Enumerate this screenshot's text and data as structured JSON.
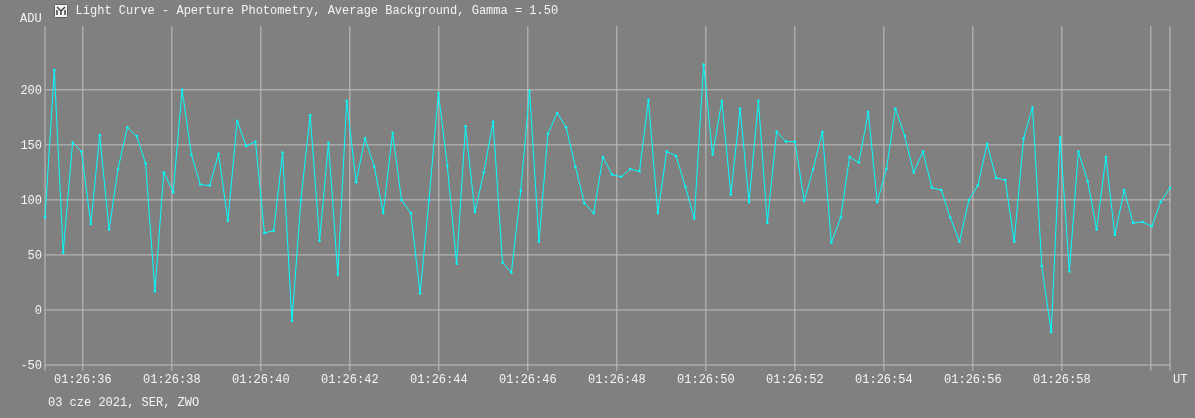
{
  "window": {
    "title": "Light Curve - Aperture Photometry, Average Background, Gamma = 1.50"
  },
  "chart": {
    "chart_data": {
      "type": "line",
      "xlabel": "UT",
      "ylabel": "ADU",
      "x": [
        5195.15,
        5195.36,
        5195.56,
        5195.77,
        5195.97,
        5196.18,
        5196.38,
        5196.59,
        5196.79,
        5197.0,
        5197.21,
        5197.41,
        5197.62,
        5197.82,
        5198.03,
        5198.23,
        5198.44,
        5198.64,
        5198.85,
        5199.05,
        5199.26,
        5199.47,
        5199.67,
        5199.88,
        5200.08,
        5200.29,
        5200.49,
        5200.7,
        5200.9,
        5201.11,
        5201.32,
        5201.52,
        5201.73,
        5201.93,
        5202.14,
        5202.34,
        5202.55,
        5202.75,
        5202.96,
        5203.16,
        5203.37,
        5203.58,
        5203.78,
        5203.99,
        5204.19,
        5204.4,
        5204.6,
        5204.81,
        5205.01,
        5205.22,
        5205.43,
        5205.63,
        5205.84,
        5206.04,
        5206.25,
        5206.45,
        5206.66,
        5206.86,
        5207.07,
        5207.27,
        5207.48,
        5207.69,
        5207.89,
        5208.1,
        5208.3,
        5208.51,
        5208.71,
        5208.92,
        5209.12,
        5209.33,
        5209.54,
        5209.74,
        5209.95,
        5210.15,
        5210.36,
        5210.56,
        5210.77,
        5210.97,
        5211.18,
        5211.38,
        5211.59,
        5211.8,
        5212.0,
        5212.21,
        5212.41,
        5212.62,
        5212.82,
        5213.03,
        5213.23,
        5213.44,
        5213.65,
        5213.85,
        5214.06,
        5214.26,
        5214.47,
        5214.67,
        5214.88,
        5215.08,
        5215.29,
        5215.49,
        5215.7,
        5215.91,
        5216.11,
        5216.32,
        5216.52,
        5216.73,
        5216.93,
        5217.14,
        5217.34,
        5217.55,
        5217.76,
        5217.96,
        5218.17,
        5218.37,
        5218.58,
        5218.78,
        5218.99,
        5219.19,
        5219.4,
        5219.6,
        5219.81,
        5220.02,
        5220.22,
        5220.43
      ],
      "series": [
        {
          "color": "#00ffff",
          "values": [
            84,
            218,
            52,
            152,
            144,
            78,
            159,
            73,
            128,
            166,
            158,
            133,
            17,
            125,
            107,
            200,
            141,
            114,
            113,
            142,
            81,
            172,
            149,
            153,
            70,
            72,
            143,
            -10,
            100,
            177,
            63,
            152,
            32,
            190,
            116,
            156,
            130,
            88,
            161,
            100,
            88,
            15,
            100,
            197,
            131,
            42,
            167,
            89,
            125,
            171,
            43,
            34,
            108,
            199,
            62,
            160,
            179,
            166,
            130,
            97,
            88,
            139,
            123,
            121,
            128,
            126,
            191,
            88,
            144,
            140,
            112,
            83,
            223,
            141,
            190,
            105,
            183,
            98,
            190,
            79,
            162,
            153,
            153,
            99,
            128,
            162,
            61,
            84,
            139,
            134,
            180,
            98,
            128,
            183,
            158,
            125,
            144,
            111,
            109,
            84,
            62,
            100,
            113,
            151,
            120,
            118,
            62,
            156,
            184,
            40,
            -20,
            157,
            35,
            144,
            117,
            73,
            139,
            68,
            109,
            79,
            80,
            76,
            98,
            111
          ]
        }
      ],
      "grid": true,
      "xlim": [
        5195.15,
        5220.43
      ],
      "ylim": [
        -50,
        258
      ],
      "xticks": [
        {
          "value": 5196,
          "label": "01:26:36"
        },
        {
          "value": 5198,
          "label": "01:26:38"
        },
        {
          "value": 5200,
          "label": "01:26:40"
        },
        {
          "value": 5202,
          "label": "01:26:42"
        },
        {
          "value": 5204,
          "label": "01:26:44"
        },
        {
          "value": 5206,
          "label": "01:26:46"
        },
        {
          "value": 5208,
          "label": "01:26:48"
        },
        {
          "value": 5210,
          "label": "01:26:50"
        },
        {
          "value": 5212,
          "label": "01:26:52"
        },
        {
          "value": 5214,
          "label": "01:26:54"
        },
        {
          "value": 5216,
          "label": "01:26:56"
        },
        {
          "value": 5218,
          "label": "01:26:58"
        }
      ],
      "yticks": [
        -50,
        0,
        50,
        100,
        150,
        200
      ]
    }
  },
  "status": {
    "text": "03 cze 2021, SER, ZWO"
  }
}
